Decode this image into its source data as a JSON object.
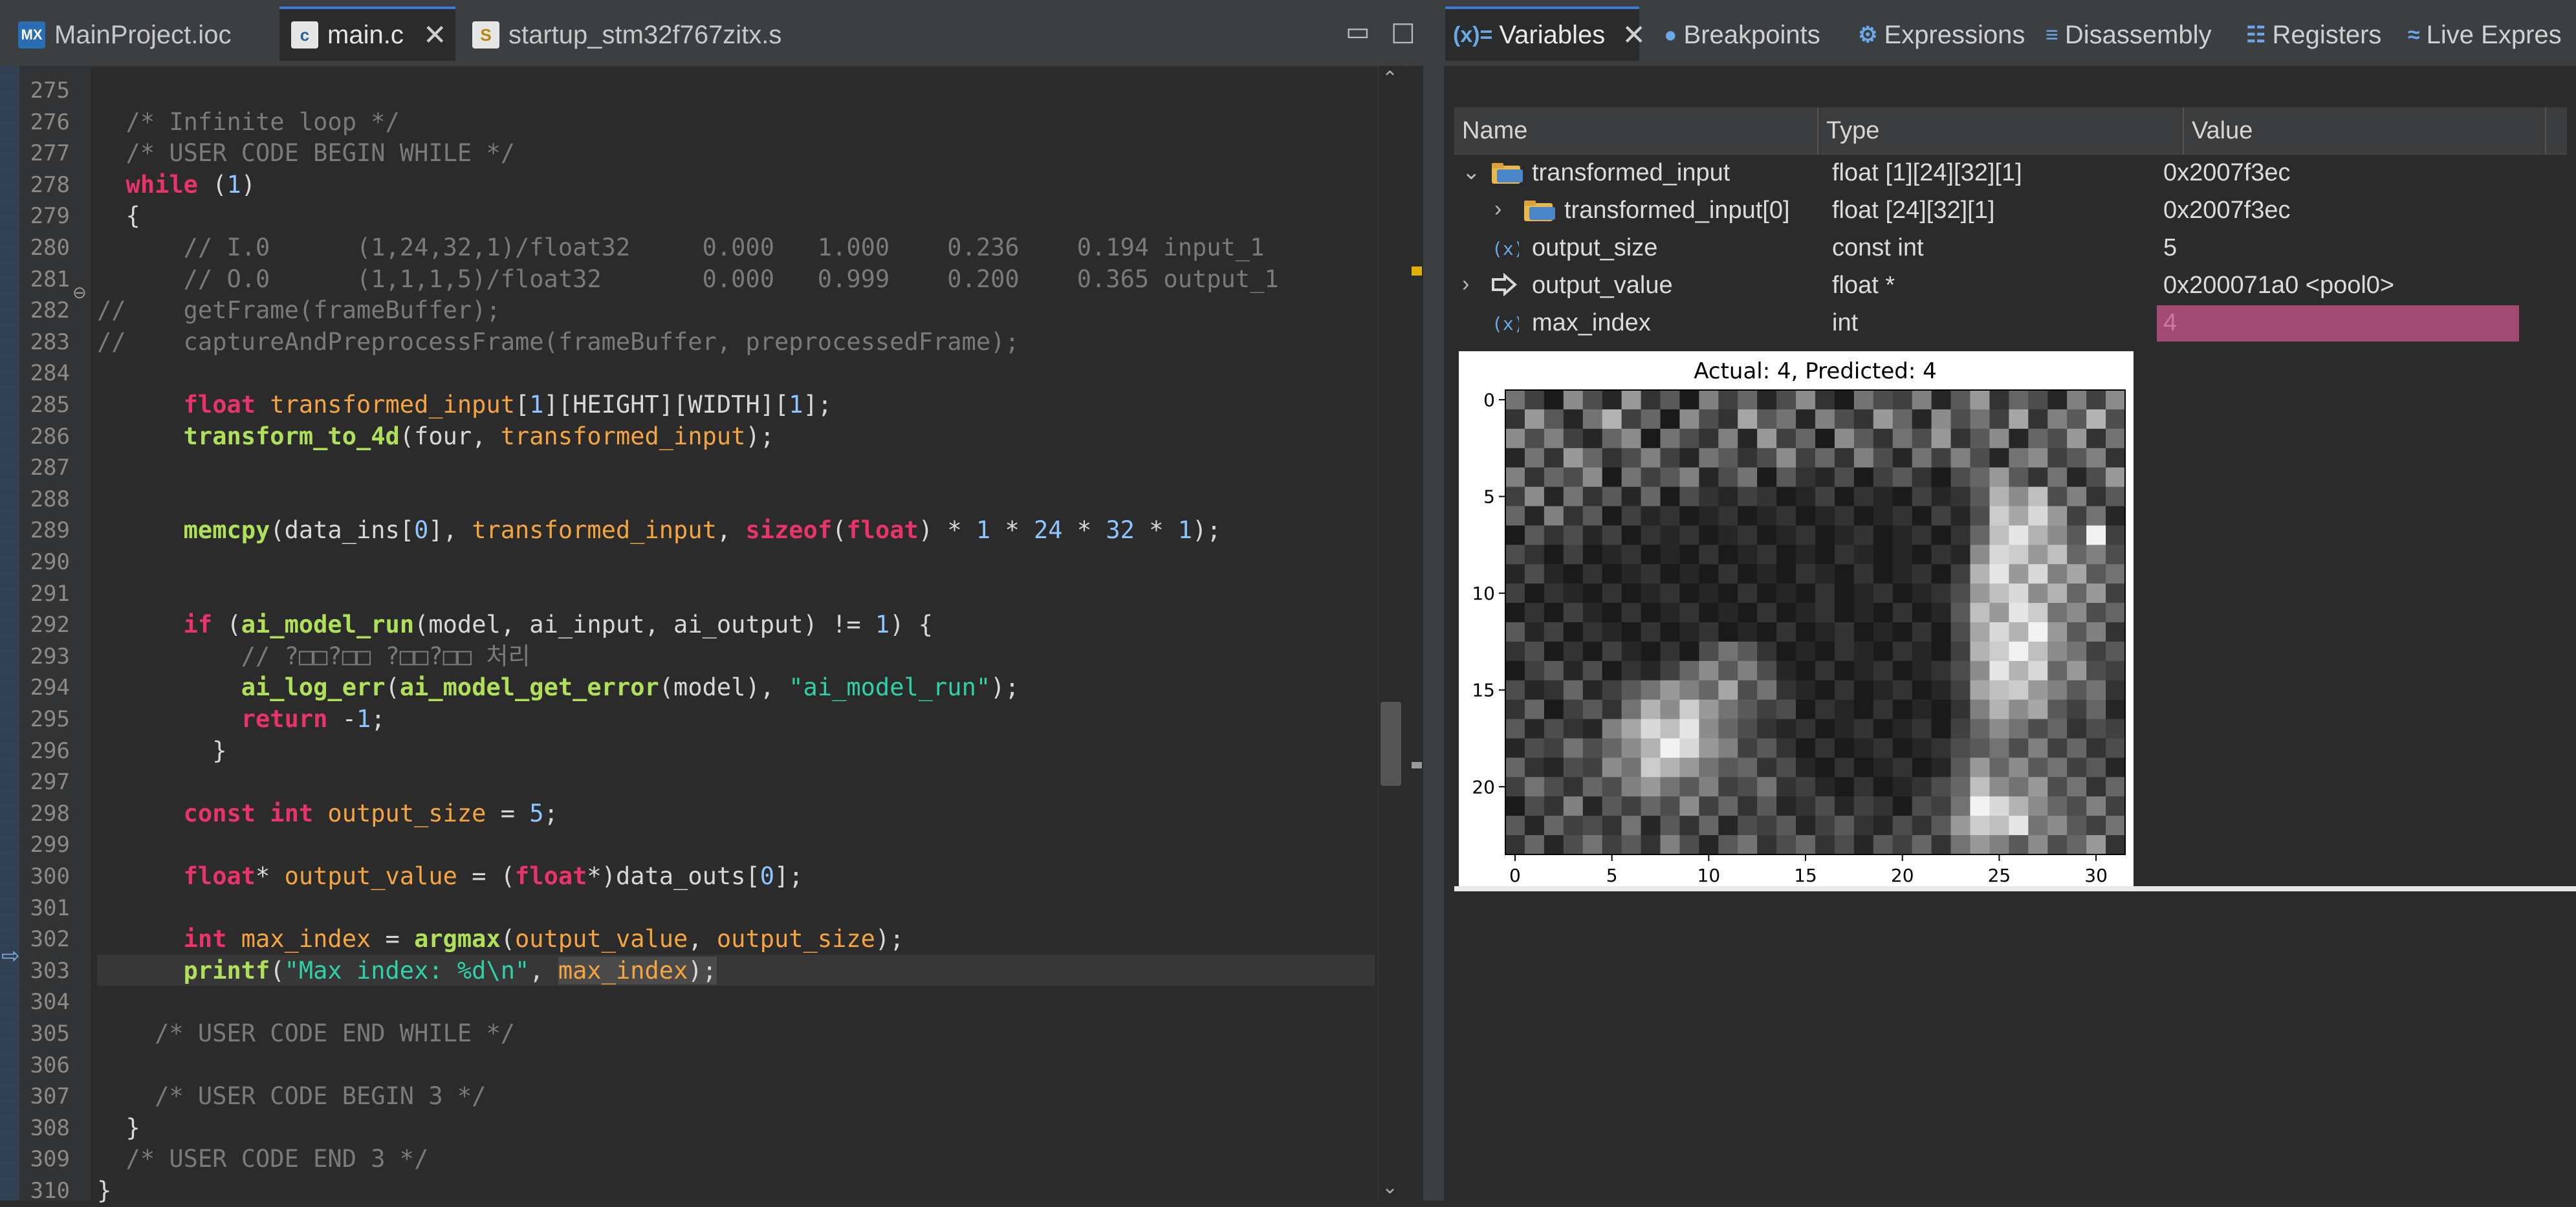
{
  "editor": {
    "tabs": [
      {
        "icon": "MX",
        "label": "MainProject.ioc"
      },
      {
        "icon": "c",
        "label": "main.c"
      },
      {
        "icon": "S",
        "label": "startup_stm32f767zitx.s"
      }
    ],
    "line_numbers": [
      "275",
      "276",
      "277",
      "278",
      "279",
      "280",
      "281",
      "282",
      "283",
      "284",
      "285",
      "286",
      "287",
      "288",
      "289",
      "290",
      "291",
      "292",
      "293",
      "294",
      "295",
      "296",
      "297",
      "298",
      "299",
      "300",
      "301",
      "302",
      "303",
      "304",
      "305",
      "306",
      "307",
      "308",
      "309",
      "310"
    ],
    "lines": [
      [],
      [
        [
          "cm",
          "  /* Infinite loop */"
        ]
      ],
      [
        [
          "cm",
          "  /* USER CODE BEGIN WHILE */"
        ]
      ],
      [
        [
          "kw",
          "  while"
        ],
        [
          "p",
          " ("
        ],
        [
          "num",
          "1"
        ],
        [
          "p",
          ")"
        ]
      ],
      [
        [
          "p",
          "  {"
        ]
      ],
      [
        [
          "cm",
          "      // I.0      (1,24,32,1)/float32     0.000   1.000    0.236    0.194 input_1"
        ]
      ],
      [
        [
          "cm",
          "      // O.0      (1,1,1,5)/float32       0.000   0.999    0.200    0.365 output_1"
        ]
      ],
      [
        [
          "cm",
          "//    getFrame(frameBuffer);"
        ]
      ],
      [
        [
          "cm",
          "//    captureAndPreprocessFrame(frameBuffer, preprocessedFrame);"
        ]
      ],
      [],
      [
        [
          "kw",
          "      float "
        ],
        [
          "var",
          "transformed_input"
        ],
        [
          "p",
          "["
        ],
        [
          "num",
          "1"
        ],
        [
          "p",
          "][HEIGHT][WIDTH]["
        ],
        [
          "num",
          "1"
        ],
        [
          "p",
          "];"
        ]
      ],
      [
        [
          "fn",
          "      transform_to_4d"
        ],
        [
          "p",
          "(four, "
        ],
        [
          "var",
          "transformed_input"
        ],
        [
          "p",
          ");"
        ]
      ],
      [],
      [],
      [
        [
          "fn",
          "      memcpy"
        ],
        [
          "p",
          "(data_ins["
        ],
        [
          "num",
          "0"
        ],
        [
          "p",
          "], "
        ],
        [
          "var",
          "transformed_input"
        ],
        [
          "p",
          ", "
        ],
        [
          "kw",
          "sizeof"
        ],
        [
          "p",
          "("
        ],
        [
          "kw",
          "float"
        ],
        [
          "p",
          ") * "
        ],
        [
          "num",
          "1"
        ],
        [
          "p",
          " * "
        ],
        [
          "num",
          "24"
        ],
        [
          "p",
          " * "
        ],
        [
          "num",
          "32"
        ],
        [
          "p",
          " * "
        ],
        [
          "num",
          "1"
        ],
        [
          "p",
          ");"
        ]
      ],
      [],
      [],
      [
        [
          "kw",
          "      if"
        ],
        [
          "p",
          " ("
        ],
        [
          "fn",
          "ai_model_run"
        ],
        [
          "p",
          "(model, ai_input, ai_output) != "
        ],
        [
          "num",
          "1"
        ],
        [
          "p",
          ") {"
        ]
      ],
      [
        [
          "cm",
          "          // ?□□?□□ ?□□?□□ 처리"
        ]
      ],
      [
        [
          "fn",
          "          ai_log_err"
        ],
        [
          "p",
          "("
        ],
        [
          "fn",
          "ai_model_get_error"
        ],
        [
          "p",
          "(model), "
        ],
        [
          "str",
          "\"ai_model_run\""
        ],
        [
          "p",
          ");"
        ]
      ],
      [
        [
          "kw",
          "          return "
        ],
        [
          "p",
          "-"
        ],
        [
          "num",
          "1"
        ],
        [
          "p",
          ";"
        ]
      ],
      [
        [
          "p",
          "        }"
        ]
      ],
      [],
      [
        [
          "kw",
          "      const int "
        ],
        [
          "var",
          "output_size"
        ],
        [
          "p",
          " = "
        ],
        [
          "num",
          "5"
        ],
        [
          "p",
          ";"
        ]
      ],
      [],
      [
        [
          "kw",
          "      float"
        ],
        [
          "p",
          "* "
        ],
        [
          "var",
          "output_value"
        ],
        [
          "p",
          " = ("
        ],
        [
          "kw",
          "float"
        ],
        [
          "p",
          "*)data_outs["
        ],
        [
          "num",
          "0"
        ],
        [
          "p",
          "];"
        ]
      ],
      [],
      [
        [
          "kw",
          "      int "
        ],
        [
          "var",
          "max_index"
        ],
        [
          "p",
          " = "
        ],
        [
          "fn",
          "argmax"
        ],
        [
          "p",
          "("
        ],
        [
          "var",
          "output_value"
        ],
        [
          "p",
          ", "
        ],
        [
          "var",
          "output_size"
        ],
        [
          "p",
          ");"
        ]
      ],
      [
        [
          "fn",
          "      printf"
        ],
        [
          "p",
          "("
        ],
        [
          "str",
          "\"Max index: %d\\n\""
        ],
        [
          "p",
          ", "
        ],
        [
          "var",
          "max_index"
        ],
        [
          "p",
          ");"
        ]
      ],
      [],
      [
        [
          "cm",
          "    /* USER CODE END WHILE */"
        ]
      ],
      [],
      [
        [
          "cm",
          "    /* USER CODE BEGIN 3 */"
        ]
      ],
      [
        [
          "p",
          "  }"
        ]
      ],
      [
        [
          "cm",
          "  /* USER CODE END 3 */"
        ]
      ],
      [
        [
          "p",
          "}"
        ]
      ]
    ]
  },
  "variables_view": {
    "tabs": [
      {
        "icon": "(x)=",
        "label": "Variables"
      },
      {
        "icon": "●",
        "label": "Breakpoints"
      },
      {
        "icon": "⚙",
        "label": "Expressions"
      },
      {
        "icon": "≡",
        "label": "Disassembly"
      },
      {
        "icon": "☷",
        "label": "Registers"
      },
      {
        "icon": "≈",
        "label": "Live Expres"
      }
    ],
    "columns": [
      "Name",
      "Type",
      "Value"
    ],
    "rows": [
      {
        "name": "transformed_input",
        "type": "float [1][24][32][1]",
        "value": "0x2007f3ec",
        "expand": "⌄",
        "icon": "struct"
      },
      {
        "name": "transformed_input[0]",
        "type": "float [24][32][1]",
        "value": "0x2007f3ec",
        "expand": "›",
        "icon": "struct"
      },
      {
        "name": "output_size",
        "type": "const int",
        "value": "5",
        "expand": "",
        "icon": "var"
      },
      {
        "name": "output_value",
        "type": "float *",
        "value": "0x200071a0 <pool0>",
        "expand": "›",
        "icon": "pointer"
      },
      {
        "name": "max_index",
        "type": "int",
        "value": "4",
        "expand": "",
        "icon": "var",
        "highlight": true
      }
    ]
  },
  "chart_data": {
    "type": "heatmap",
    "title": "Actual: 4, Predicted: 4",
    "colormap": "gray",
    "rows": 24,
    "cols": 32,
    "xticks": [
      0,
      5,
      10,
      15,
      20,
      25,
      30
    ],
    "yticks": [
      0,
      5,
      10,
      15,
      20
    ],
    "values": [
      [
        0.45,
        0.25,
        0.1,
        0.55,
        0.3,
        0.15,
        0.6,
        0.2,
        0.35,
        0.1,
        0.5,
        0.25,
        0.4,
        0.15,
        0.3,
        0.55,
        0.2,
        0.1,
        0.45,
        0.3,
        0.25,
        0.5,
        0.15,
        0.35,
        0.6,
        0.2,
        0.4,
        0.3,
        0.15,
        0.5,
        0.25,
        0.55
      ],
      [
        0.2,
        0.6,
        0.35,
        0.15,
        0.45,
        0.7,
        0.25,
        0.4,
        0.1,
        0.55,
        0.3,
        0.2,
        0.65,
        0.35,
        0.45,
        0.15,
        0.5,
        0.3,
        0.2,
        0.6,
        0.4,
        0.15,
        0.55,
        0.3,
        0.45,
        0.25,
        0.65,
        0.2,
        0.5,
        0.35,
        0.7,
        0.3
      ],
      [
        0.55,
        0.3,
        0.5,
        0.25,
        0.15,
        0.4,
        0.55,
        0.1,
        0.45,
        0.3,
        0.2,
        0.5,
        0.15,
        0.6,
        0.25,
        0.4,
        0.1,
        0.55,
        0.35,
        0.2,
        0.45,
        0.3,
        0.6,
        0.2,
        0.35,
        0.55,
        0.15,
        0.4,
        0.3,
        0.6,
        0.2,
        0.45
      ],
      [
        0.15,
        0.45,
        0.2,
        0.6,
        0.4,
        0.2,
        0.3,
        0.5,
        0.25,
        0.15,
        0.45,
        0.35,
        0.2,
        0.3,
        0.55,
        0.25,
        0.4,
        0.2,
        0.5,
        0.3,
        0.15,
        0.45,
        0.25,
        0.5,
        0.3,
        0.15,
        0.45,
        0.55,
        0.25,
        0.35,
        0.5,
        0.2
      ],
      [
        0.5,
        0.2,
        0.4,
        0.3,
        0.55,
        0.1,
        0.45,
        0.25,
        0.35,
        0.5,
        0.15,
        0.3,
        0.45,
        0.1,
        0.35,
        0.2,
        0.15,
        0.3,
        0.1,
        0.25,
        0.35,
        0.2,
        0.1,
        0.3,
        0.4,
        0.6,
        0.35,
        0.2,
        0.45,
        0.15,
        0.3,
        0.6
      ],
      [
        0.25,
        0.55,
        0.15,
        0.45,
        0.2,
        0.35,
        0.15,
        0.4,
        0.1,
        0.3,
        0.2,
        0.15,
        0.25,
        0.2,
        0.1,
        0.15,
        0.25,
        0.1,
        0.2,
        0.15,
        0.1,
        0.25,
        0.15,
        0.2,
        0.35,
        0.7,
        0.55,
        0.75,
        0.3,
        0.5,
        0.2,
        0.35
      ],
      [
        0.4,
        0.15,
        0.5,
        0.2,
        0.35,
        0.1,
        0.25,
        0.15,
        0.2,
        0.1,
        0.15,
        0.2,
        0.1,
        0.15,
        0.2,
        0.1,
        0.15,
        0.2,
        0.1,
        0.15,
        0.2,
        0.1,
        0.25,
        0.15,
        0.3,
        0.8,
        0.65,
        0.85,
        0.6,
        0.25,
        0.45,
        0.15
      ],
      [
        0.1,
        0.35,
        0.2,
        0.3,
        0.15,
        0.25,
        0.1,
        0.2,
        0.15,
        0.2,
        0.1,
        0.15,
        0.2,
        0.1,
        0.15,
        0.2,
        0.1,
        0.15,
        0.2,
        0.1,
        0.15,
        0.2,
        0.1,
        0.2,
        0.4,
        0.75,
        0.9,
        0.7,
        0.55,
        0.35,
        0.95,
        0.25
      ],
      [
        0.3,
        0.2,
        0.1,
        0.25,
        0.1,
        0.15,
        0.2,
        0.1,
        0.15,
        0.1,
        0.2,
        0.1,
        0.15,
        0.2,
        0.1,
        0.15,
        0.1,
        0.2,
        0.15,
        0.1,
        0.15,
        0.1,
        0.2,
        0.15,
        0.55,
        0.85,
        0.8,
        0.6,
        0.75,
        0.4,
        0.5,
        0.3
      ],
      [
        0.15,
        0.3,
        0.15,
        0.1,
        0.2,
        0.1,
        0.15,
        0.2,
        0.1,
        0.15,
        0.1,
        0.2,
        0.1,
        0.15,
        0.1,
        0.2,
        0.15,
        0.1,
        0.2,
        0.1,
        0.15,
        0.2,
        0.1,
        0.25,
        0.7,
        0.9,
        0.6,
        0.85,
        0.5,
        0.65,
        0.35,
        0.45
      ],
      [
        0.25,
        0.1,
        0.2,
        0.15,
        0.1,
        0.2,
        0.1,
        0.15,
        0.2,
        0.1,
        0.15,
        0.1,
        0.2,
        0.1,
        0.15,
        0.1,
        0.2,
        0.1,
        0.15,
        0.2,
        0.1,
        0.15,
        0.2,
        0.3,
        0.6,
        0.75,
        0.85,
        0.55,
        0.7,
        0.4,
        0.6,
        0.25
      ],
      [
        0.1,
        0.2,
        0.1,
        0.25,
        0.15,
        0.1,
        0.2,
        0.1,
        0.15,
        0.2,
        0.1,
        0.15,
        0.1,
        0.2,
        0.1,
        0.15,
        0.2,
        0.1,
        0.15,
        0.1,
        0.2,
        0.1,
        0.15,
        0.35,
        0.75,
        0.6,
        0.9,
        0.8,
        0.45,
        0.55,
        0.3,
        0.4
      ],
      [
        0.35,
        0.15,
        0.25,
        0.1,
        0.2,
        0.15,
        0.1,
        0.2,
        0.1,
        0.15,
        0.2,
        0.1,
        0.15,
        0.1,
        0.2,
        0.1,
        0.15,
        0.2,
        0.1,
        0.15,
        0.1,
        0.2,
        0.1,
        0.3,
        0.65,
        0.85,
        0.7,
        0.95,
        0.6,
        0.35,
        0.5,
        0.2
      ],
      [
        0.2,
        0.3,
        0.1,
        0.2,
        0.1,
        0.25,
        0.15,
        0.1,
        0.2,
        0.1,
        0.3,
        0.45,
        0.35,
        0.2,
        0.1,
        0.15,
        0.1,
        0.2,
        0.15,
        0.1,
        0.2,
        0.15,
        0.1,
        0.25,
        0.7,
        0.8,
        0.95,
        0.75,
        0.55,
        0.45,
        0.25,
        0.35
      ],
      [
        0.1,
        0.25,
        0.35,
        0.15,
        0.3,
        0.1,
        0.2,
        0.15,
        0.25,
        0.4,
        0.55,
        0.35,
        0.5,
        0.3,
        0.15,
        0.1,
        0.2,
        0.1,
        0.15,
        0.2,
        0.1,
        0.15,
        0.2,
        0.3,
        0.55,
        0.9,
        0.7,
        0.85,
        0.4,
        0.6,
        0.3,
        0.25
      ],
      [
        0.3,
        0.15,
        0.2,
        0.4,
        0.15,
        0.25,
        0.35,
        0.45,
        0.6,
        0.5,
        0.4,
        0.65,
        0.3,
        0.45,
        0.2,
        0.15,
        0.1,
        0.2,
        0.1,
        0.15,
        0.2,
        0.1,
        0.15,
        0.25,
        0.65,
        0.75,
        0.8,
        0.6,
        0.5,
        0.35,
        0.45,
        0.2
      ],
      [
        0.2,
        0.4,
        0.1,
        0.25,
        0.35,
        0.2,
        0.45,
        0.7,
        0.55,
        0.8,
        0.6,
        0.45,
        0.35,
        0.25,
        0.3,
        0.1,
        0.2,
        0.15,
        0.1,
        0.2,
        0.1,
        0.15,
        0.1,
        0.2,
        0.5,
        0.7,
        0.55,
        0.65,
        0.35,
        0.25,
        0.4,
        0.15
      ],
      [
        0.35,
        0.15,
        0.3,
        0.2,
        0.15,
        0.5,
        0.65,
        0.85,
        0.75,
        0.9,
        0.55,
        0.4,
        0.3,
        0.2,
        0.15,
        0.2,
        0.1,
        0.15,
        0.2,
        0.1,
        0.15,
        0.2,
        0.1,
        0.25,
        0.4,
        0.55,
        0.45,
        0.3,
        0.4,
        0.2,
        0.3,
        0.25
      ],
      [
        0.15,
        0.3,
        0.25,
        0.45,
        0.3,
        0.4,
        0.55,
        0.7,
        0.95,
        0.85,
        0.6,
        0.5,
        0.25,
        0.35,
        0.2,
        0.1,
        0.2,
        0.1,
        0.15,
        0.2,
        0.1,
        0.15,
        0.2,
        0.3,
        0.35,
        0.45,
        0.3,
        0.5,
        0.25,
        0.4,
        0.2,
        0.3
      ],
      [
        0.4,
        0.2,
        0.15,
        0.3,
        0.25,
        0.55,
        0.45,
        0.8,
        0.7,
        0.6,
        0.45,
        0.35,
        0.4,
        0.2,
        0.3,
        0.15,
        0.1,
        0.2,
        0.1,
        0.15,
        0.2,
        0.1,
        0.15,
        0.35,
        0.6,
        0.4,
        0.55,
        0.35,
        0.45,
        0.25,
        0.35,
        0.15
      ],
      [
        0.25,
        0.45,
        0.3,
        0.2,
        0.4,
        0.3,
        0.5,
        0.6,
        0.45,
        0.35,
        0.5,
        0.25,
        0.3,
        0.45,
        0.2,
        0.25,
        0.15,
        0.1,
        0.2,
        0.1,
        0.15,
        0.2,
        0.3,
        0.4,
        0.75,
        0.55,
        0.45,
        0.6,
        0.3,
        0.45,
        0.2,
        0.4
      ],
      [
        0.1,
        0.3,
        0.2,
        0.5,
        0.15,
        0.35,
        0.25,
        0.4,
        0.3,
        0.55,
        0.25,
        0.4,
        0.2,
        0.35,
        0.15,
        0.2,
        0.3,
        0.15,
        0.25,
        0.2,
        0.1,
        0.3,
        0.25,
        0.45,
        0.95,
        0.85,
        0.7,
        0.55,
        0.4,
        0.3,
        0.5,
        0.25
      ],
      [
        0.35,
        0.15,
        0.4,
        0.25,
        0.3,
        0.2,
        0.45,
        0.15,
        0.35,
        0.2,
        0.4,
        0.15,
        0.3,
        0.25,
        0.35,
        0.15,
        0.25,
        0.35,
        0.2,
        0.15,
        0.3,
        0.2,
        0.35,
        0.6,
        0.8,
        0.75,
        0.9,
        0.45,
        0.55,
        0.35,
        0.25,
        0.45
      ],
      [
        0.2,
        0.4,
        0.15,
        0.3,
        0.45,
        0.25,
        0.35,
        0.2,
        0.5,
        0.3,
        0.15,
        0.35,
        0.45,
        0.2,
        0.3,
        0.4,
        0.2,
        0.3,
        0.15,
        0.35,
        0.25,
        0.4,
        0.2,
        0.45,
        0.6,
        0.5,
        0.35,
        0.55,
        0.3,
        0.4,
        0.6,
        0.2
      ]
    ]
  }
}
